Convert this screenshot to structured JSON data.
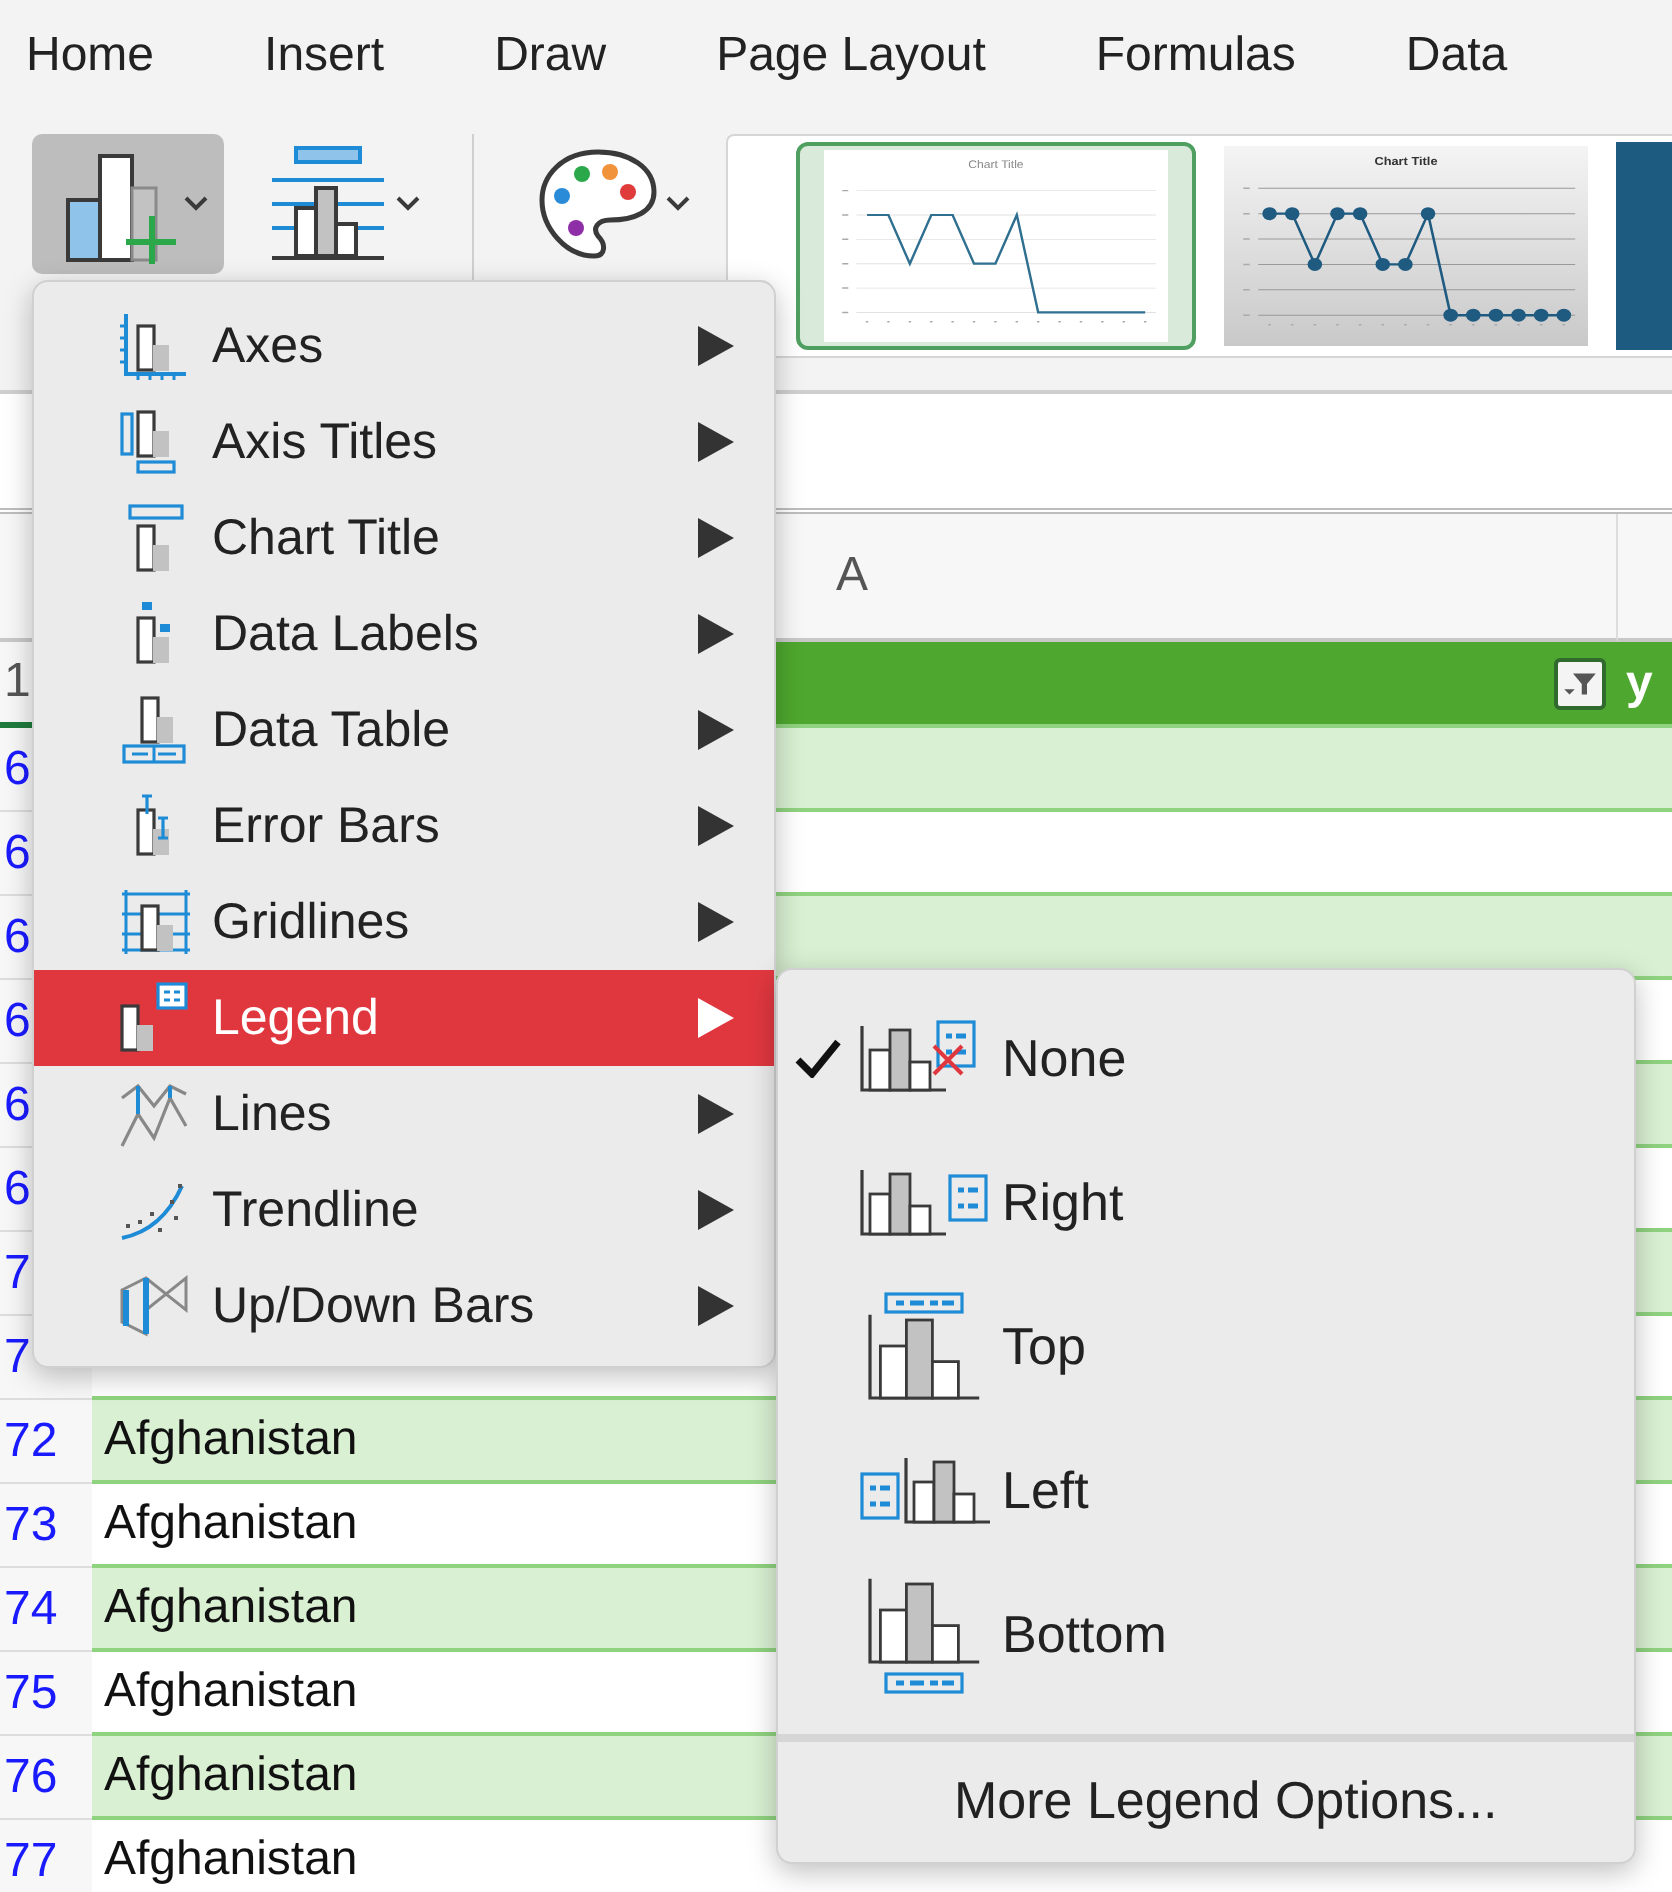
{
  "tabs": [
    {
      "label": "Home"
    },
    {
      "label": "Insert"
    },
    {
      "label": "Draw"
    },
    {
      "label": "Page Layout"
    },
    {
      "label": "Formulas"
    },
    {
      "label": "Data"
    }
  ],
  "ribbon": {
    "buttons": [
      {
        "kind": "chart-elements",
        "selected": true
      },
      {
        "kind": "quick-layout",
        "selected": false
      },
      {
        "kind": "colors",
        "selected": false
      }
    ],
    "styles": [
      {
        "kind": "plain",
        "selected": true,
        "title": "Chart Title"
      },
      {
        "kind": "markers",
        "selected": false,
        "title": "Chart Title"
      },
      {
        "kind": "dark",
        "selected": false
      }
    ]
  },
  "sheet": {
    "columns": [
      "A"
    ],
    "header_row": {
      "number": "1",
      "filter": true,
      "column_2": "y"
    },
    "rows": [
      {
        "number": "6",
        "banded": true
      },
      {
        "number": "6",
        "banded": false
      },
      {
        "number": "6",
        "banded": true
      },
      {
        "number": "6",
        "banded": false
      },
      {
        "number": "6",
        "banded": true
      },
      {
        "number": "6",
        "banded": false
      },
      {
        "number": "7",
        "banded": true
      },
      {
        "number": "7",
        "banded": false
      },
      {
        "number": "72",
        "banded": true,
        "cell": "Afghanistan"
      },
      {
        "number": "73",
        "banded": false,
        "cell": "Afghanistan"
      },
      {
        "number": "74",
        "banded": true,
        "cell": "Afghanistan"
      },
      {
        "number": "75",
        "banded": false,
        "cell": "Afghanistan"
      },
      {
        "number": "76",
        "banded": true,
        "cell": "Afghanistan"
      },
      {
        "number": "77",
        "banded": false,
        "cell": "Afghanistan"
      }
    ]
  },
  "menu": {
    "items": [
      {
        "label": "Axes",
        "kind": "axes",
        "selected": false
      },
      {
        "label": "Axis Titles",
        "kind": "axis-titles",
        "selected": false
      },
      {
        "label": "Chart Title",
        "kind": "chart-title",
        "selected": false
      },
      {
        "label": "Data Labels",
        "kind": "data-labels",
        "selected": false
      },
      {
        "label": "Data Table",
        "kind": "data-table",
        "selected": false
      },
      {
        "label": "Error Bars",
        "kind": "error-bars",
        "selected": false
      },
      {
        "label": "Gridlines",
        "kind": "gridlines",
        "selected": false
      },
      {
        "label": "Legend",
        "kind": "legend",
        "selected": true
      },
      {
        "label": "Lines",
        "kind": "lines",
        "selected": false
      },
      {
        "label": "Trendline",
        "kind": "trendline",
        "selected": false
      },
      {
        "label": "Up/Down Bars",
        "kind": "updown",
        "selected": false
      }
    ]
  },
  "submenu": {
    "items": [
      {
        "label": "None",
        "kind": "none",
        "checked": true
      },
      {
        "label": "Right",
        "kind": "right",
        "checked": false
      },
      {
        "label": "Top",
        "kind": "top",
        "checked": false
      },
      {
        "label": "Left",
        "kind": "left",
        "checked": false
      },
      {
        "label": "Bottom",
        "kind": "bottom",
        "checked": false
      }
    ],
    "footer": "More Legend Options..."
  }
}
